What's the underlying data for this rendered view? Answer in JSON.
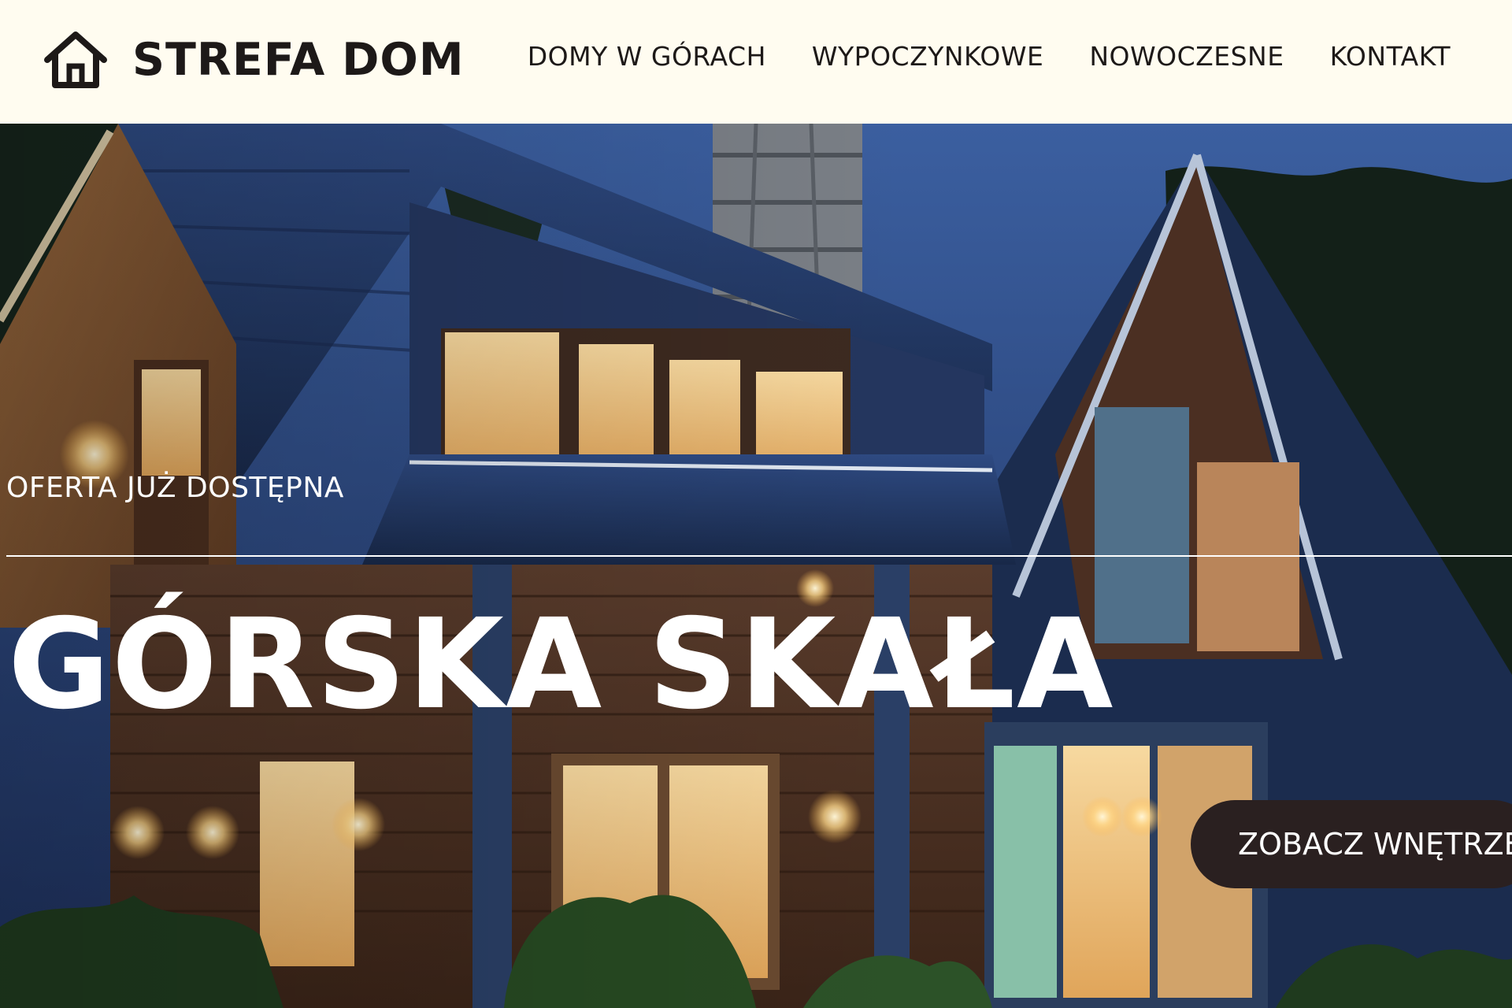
{
  "brand": {
    "name": "STREFA DOM",
    "icon": "house-icon",
    "text_color": "#1d1918"
  },
  "nav": {
    "items": [
      {
        "label": "DOMY W GÓRACH"
      },
      {
        "label": "WYPOCZYNKOWE"
      },
      {
        "label": "NOWOCZESNE"
      },
      {
        "label": "KONTAKT"
      }
    ]
  },
  "hero": {
    "eyebrow": "OFERTA JUŻ DOSTĘPNA",
    "title": "GÓRSKA SKAŁA",
    "cta_label": "ZOBACZ WNĘTRZE",
    "background_image": "evening-mountain-house-photo"
  },
  "colors": {
    "header_bg": "#fffcf0",
    "text_dark": "#1d1918",
    "cta_bg": "#2a2020",
    "hero_text": "#ffffff"
  }
}
